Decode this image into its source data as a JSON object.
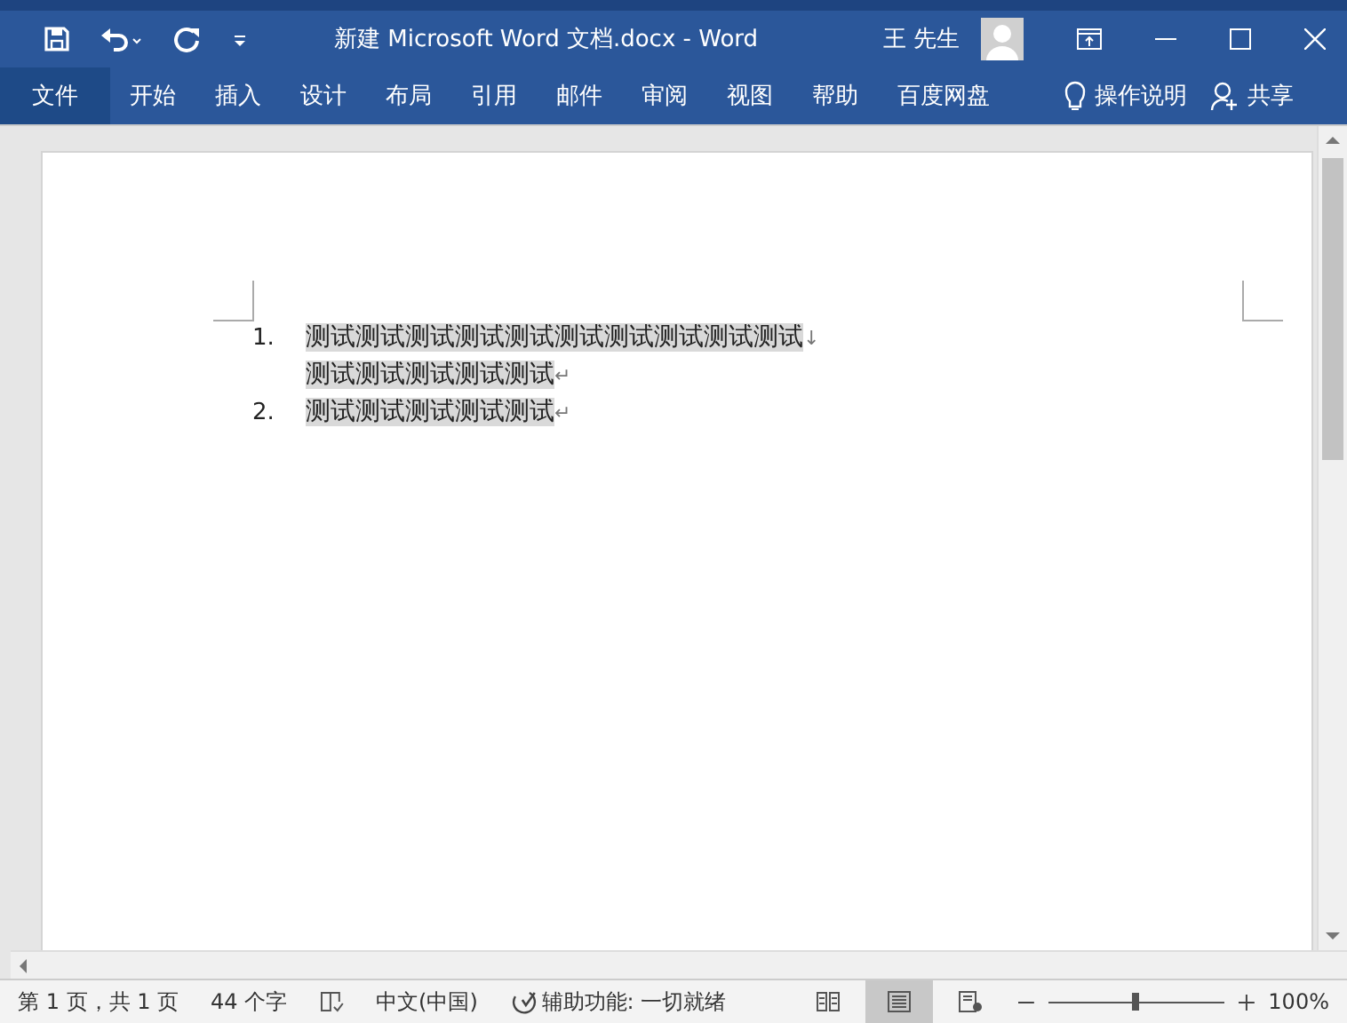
{
  "title_bar": {
    "title": "新建 Microsoft Word 文档.docx  -  Word",
    "user": "王 先生"
  },
  "ribbon": {
    "tabs": [
      {
        "label": "文件",
        "kind": "file"
      },
      {
        "label": "开始",
        "kind": "tab"
      },
      {
        "label": "插入",
        "kind": "tab"
      },
      {
        "label": "设计",
        "kind": "tab"
      },
      {
        "label": "布局",
        "kind": "tab"
      },
      {
        "label": "引用",
        "kind": "tab"
      },
      {
        "label": "邮件",
        "kind": "tab"
      },
      {
        "label": "审阅",
        "kind": "tab"
      },
      {
        "label": "视图",
        "kind": "tab"
      },
      {
        "label": "帮助",
        "kind": "tab"
      },
      {
        "label": "百度网盘",
        "kind": "tab"
      }
    ],
    "tell_me": "操作说明",
    "share": "共享"
  },
  "document": {
    "list": [
      {
        "number": "1.",
        "lines": [
          {
            "text": "测试测试测试测试测试测试测试测试测试测试",
            "mark": "↓"
          },
          {
            "text": "测试测试测试测试测试",
            "mark": "↵"
          }
        ]
      },
      {
        "number": "2.",
        "lines": [
          {
            "text": "测试测试测试测试测试",
            "mark": "↵"
          }
        ]
      }
    ]
  },
  "status_bar": {
    "page": "第 1 页，共 1 页",
    "words": "44 个字",
    "language": "中文(中国)",
    "accessibility": "辅助功能: 一切就绪",
    "views": [
      {
        "kind": "read",
        "selected": false
      },
      {
        "kind": "print",
        "selected": true
      },
      {
        "kind": "web",
        "selected": false
      }
    ],
    "zoom": {
      "level": 0.5,
      "reading": "100%"
    }
  }
}
